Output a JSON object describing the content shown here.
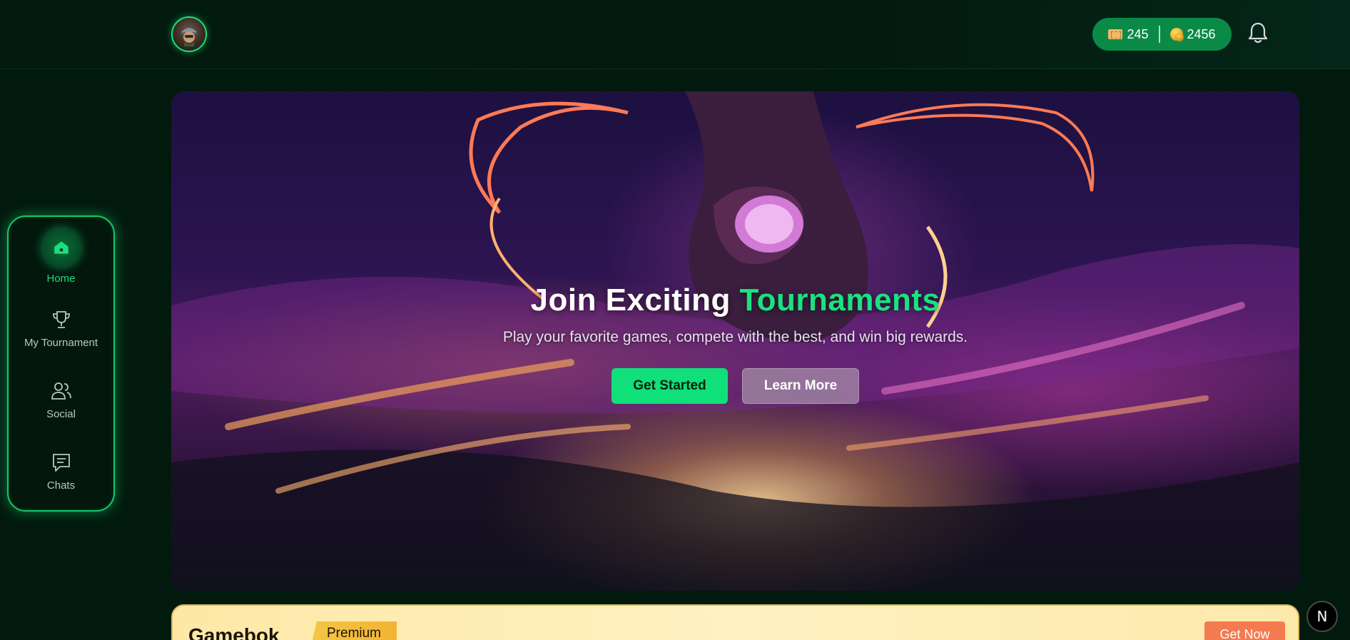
{
  "header": {
    "tickets": "245",
    "coins": "2456"
  },
  "sidebar": {
    "items": [
      {
        "label": "Home",
        "icon": "home-icon",
        "active": true
      },
      {
        "label": "My Tournament",
        "icon": "trophy-icon",
        "active": false
      },
      {
        "label": "Social",
        "icon": "users-icon",
        "active": false
      },
      {
        "label": "Chats",
        "icon": "chat-icon",
        "active": false
      }
    ]
  },
  "hero": {
    "title_part1": "Join Exciting ",
    "title_accent": "Tournaments",
    "subtitle": "Play your favorite games, compete with the best, and win big rewards.",
    "primary_button": "Get Started",
    "secondary_button": "Learn More"
  },
  "premium": {
    "brand": "Gamebok",
    "badge": "Premium",
    "cta": "Get Now"
  },
  "badge_letter": "N",
  "colors": {
    "accent": "#19e37f",
    "background": "#021a0e",
    "premium_cta": "#f47a50"
  }
}
